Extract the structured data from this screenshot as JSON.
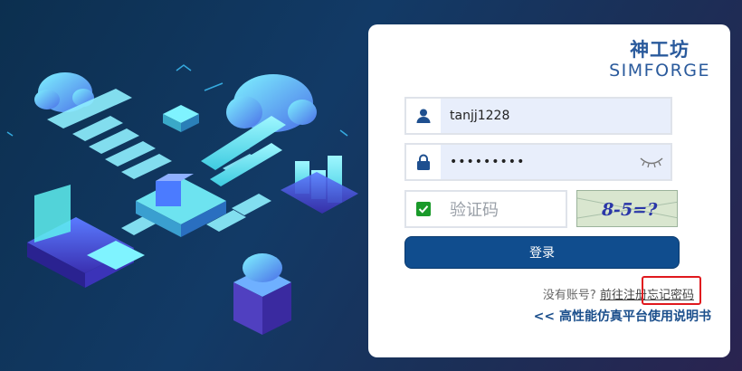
{
  "brand": {
    "name_cn": "神工坊",
    "name_en": "SIMFORGE"
  },
  "login": {
    "username_value": "tanjj1228",
    "password_value": "•••••••••",
    "captcha_placeholder": "验证码",
    "captcha_image_text": "8-5=?",
    "submit_label": "登录"
  },
  "links": {
    "no_account_text": "没有账号?",
    "register_label": "前往注册",
    "forgot_label": "忘记密码",
    "manual_label": "<< 高性能仿真平台使用说明书"
  },
  "icons": {
    "user": "user-icon",
    "lock": "lock-icon",
    "check": "check-icon",
    "eye": "eye-closed-icon"
  },
  "colors": {
    "primary": "#104d8e",
    "brand": "#2a5a9c",
    "highlight": "#e0191e",
    "field_fill": "#e8eefb"
  }
}
